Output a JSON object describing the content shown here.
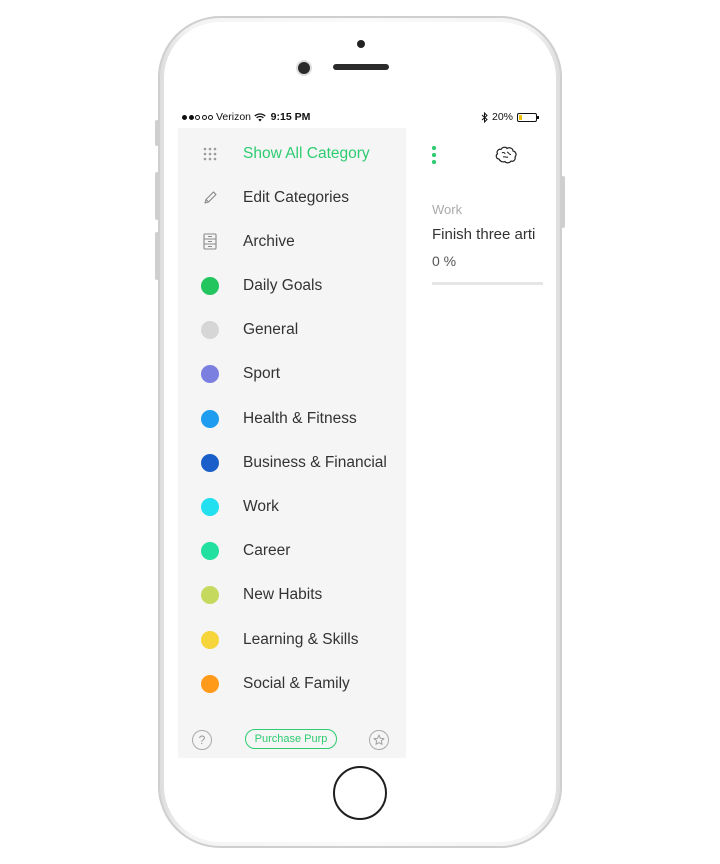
{
  "status_bar": {
    "carrier": "Verizon",
    "time": "9:15 PM",
    "battery": "20%",
    "battery_level": 0.2
  },
  "drawer": {
    "show_all": "Show All Category",
    "edit": "Edit Categories",
    "archive": "Archive",
    "categories": [
      {
        "label": "Daily Goals",
        "color": "#22c55e"
      },
      {
        "label": "General",
        "color": "#d6d6d6"
      },
      {
        "label": "Sport",
        "color": "#7b7fe0"
      },
      {
        "label": "Health & Fitness",
        "color": "#1e9cf0"
      },
      {
        "label": "Business & Financial",
        "color": "#1a5fc9"
      },
      {
        "label": "Work",
        "color": "#22e0f0"
      },
      {
        "label": "Career",
        "color": "#22e0a0"
      },
      {
        "label": "New Habits",
        "color": "#c6d95f"
      },
      {
        "label": "Learning & Skills",
        "color": "#f5d53a"
      },
      {
        "label": "Social & Family",
        "color": "#ff9a1a"
      }
    ],
    "footer": {
      "help": "?",
      "purchase": "Purchase Purp"
    }
  },
  "main": {
    "task": {
      "category": "Work",
      "title": "Finish three arti",
      "progress": "0 %"
    }
  },
  "colors": {
    "accent": "#2ecc71"
  }
}
